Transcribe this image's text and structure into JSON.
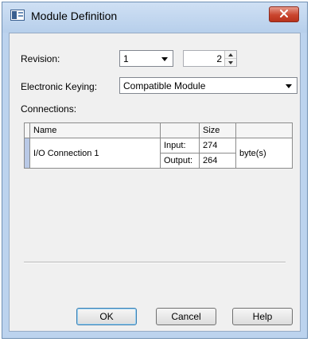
{
  "dialog": {
    "title": "Module Definition"
  },
  "revision": {
    "label": "Revision:",
    "major": "1",
    "minor": "2"
  },
  "keying": {
    "label": "Electronic Keying:",
    "value": "Compatible Module"
  },
  "connections": {
    "label": "Connections:",
    "headers": {
      "name": "Name",
      "blank": "",
      "size": "Size"
    },
    "rows": [
      {
        "name": "I/O Connection 1",
        "input_label": "Input:",
        "input_value": "274",
        "output_label": "Output:",
        "output_value": "264",
        "unit": "byte(s)"
      }
    ]
  },
  "buttons": {
    "ok": "OK",
    "cancel": "Cancel",
    "help": "Help"
  },
  "colors": {
    "titlebar": "#bcd3ee",
    "close_button": "#c9452e",
    "selection_marker": "#b9c9e6"
  }
}
